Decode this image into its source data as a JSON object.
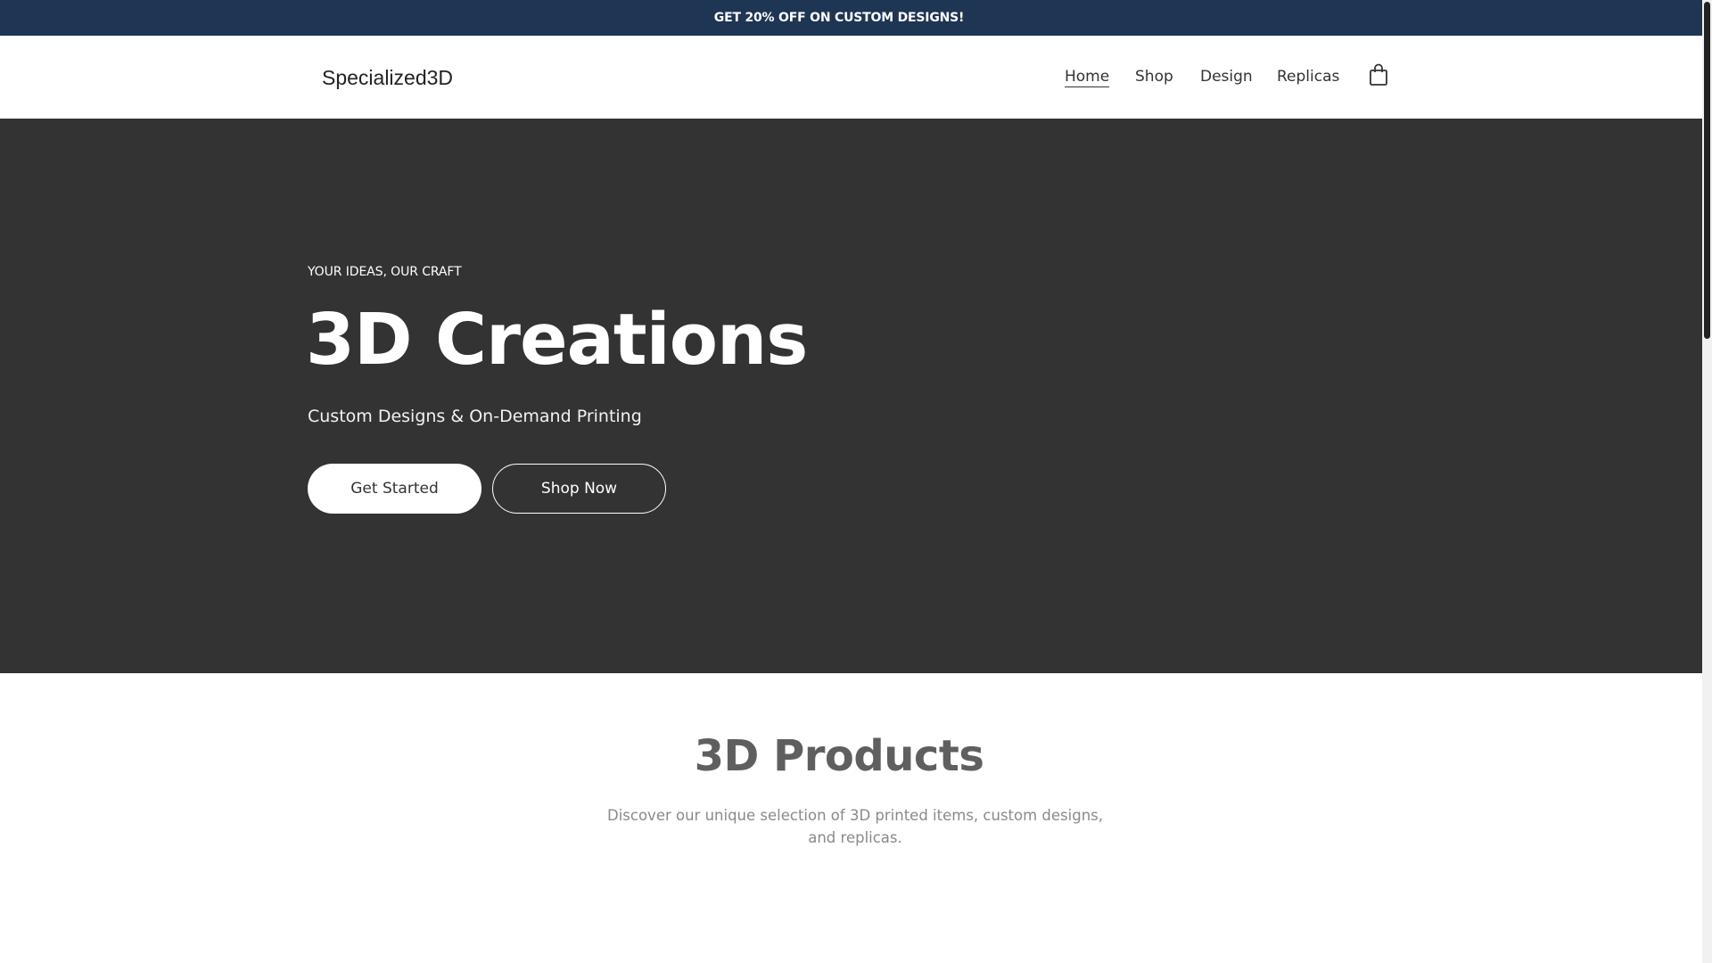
{
  "announcement": {
    "text": "GET 20% OFF ON CUSTOM DESIGNS!"
  },
  "header": {
    "logo": "Specialized3D",
    "nav": [
      {
        "label": "Home",
        "active": true
      },
      {
        "label": "Shop",
        "active": false
      },
      {
        "label": "Design",
        "active": false
      },
      {
        "label": "Replicas",
        "active": false
      }
    ],
    "cart_icon": "shopping-bag-icon"
  },
  "hero": {
    "eyebrow": "YOUR IDEAS, OUR CRAFT",
    "title": "3D Creations",
    "subtitle": "Custom Designs & On-Demand Printing",
    "primary_button": "Get Started",
    "secondary_button": "Shop Now"
  },
  "products": {
    "title": "3D Products",
    "description": "Discover our unique selection of 3D printed items, custom designs, and replicas."
  },
  "colors": {
    "announcement_bg": "#1e3553",
    "hero_bg": "#333333",
    "scrollbar_thumb": "#222222"
  }
}
